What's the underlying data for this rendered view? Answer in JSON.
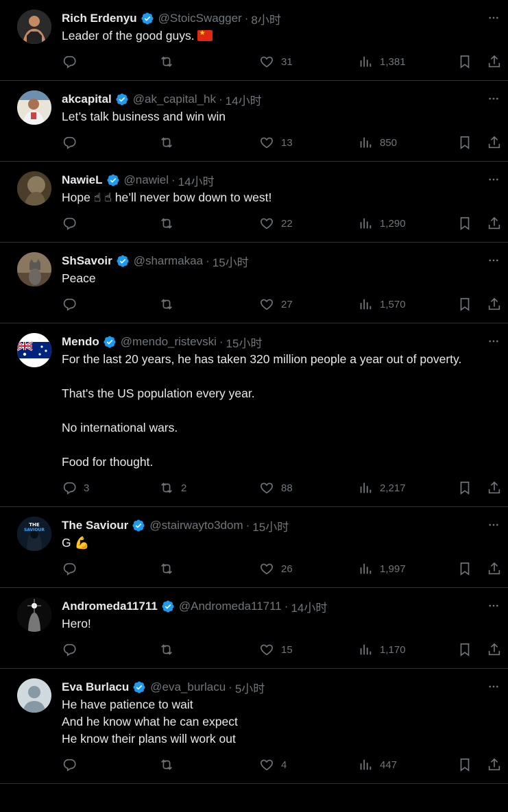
{
  "colors": {
    "background": "#000000",
    "text": "#e7e9ea",
    "muted": "#71767b",
    "verified": "#1d9bf0",
    "divider": "#2f3336"
  },
  "icons": {
    "reply": "speech-bubble-icon",
    "retweet": "retweet-icon",
    "like": "heart-icon",
    "views": "bar-chart-icon",
    "bookmark": "bookmark-icon",
    "share": "share-icon",
    "more": "more-dots-icon",
    "verified": "verified-badge-icon"
  },
  "tweets": [
    {
      "name": "Rich Erdenyu",
      "handle": "@StoicSwagger",
      "time": "8小时",
      "paragraphs": [
        "Leader of the good guys."
      ],
      "emoji_flag": "🇨🇳",
      "replies": "",
      "retweets": "",
      "likes": "31",
      "views": "1,381"
    },
    {
      "name": "akcapital",
      "handle": "@ak_capital_hk",
      "time": "14小时",
      "paragraphs": [
        "Let’s talk business and win win"
      ],
      "replies": "",
      "retweets": "",
      "likes": "13",
      "views": "850"
    },
    {
      "name": "NawieL",
      "handle": "@nawiel",
      "time": "14小时",
      "paragraphs": [
        "Hope ☝ ☝ he’ll never bow down to west!"
      ],
      "replies": "",
      "retweets": "",
      "likes": "22",
      "views": "1,290"
    },
    {
      "name": "ShSavoir",
      "handle": "@sharmakaa",
      "time": "15小时",
      "paragraphs": [
        "Peace"
      ],
      "replies": "",
      "retweets": "",
      "likes": "27",
      "views": "1,570"
    },
    {
      "name": "Mendo",
      "handle": "@mendo_ristevski",
      "time": "15小时",
      "paragraphs": [
        "For the last 20 years, he has taken 320 million people a year out of poverty.",
        "That's the US population every year.",
        "No international wars.",
        "Food for thought."
      ],
      "replies": "3",
      "retweets": "2",
      "likes": "88",
      "views": "2,217"
    },
    {
      "name": "The Saviour",
      "handle": "@stairwayto3dom",
      "time": "15小时",
      "paragraphs": [
        "G 💪"
      ],
      "replies": "",
      "retweets": "",
      "likes": "26",
      "views": "1,997"
    },
    {
      "name": "Andromeda11711",
      "handle": "@Andromeda11711",
      "time": "14小时",
      "paragraphs": [
        "Hero!"
      ],
      "replies": "",
      "retweets": "",
      "likes": "15",
      "views": "1,170"
    },
    {
      "name": "Eva Burlacu",
      "handle": "@eva_burlacu",
      "time": "5小时",
      "paragraphs": [
        "He have patience to wait\nAnd he know what he can expect\nHe know their plans will work out"
      ],
      "replies": "",
      "retweets": "",
      "likes": "4",
      "views": "447"
    }
  ]
}
